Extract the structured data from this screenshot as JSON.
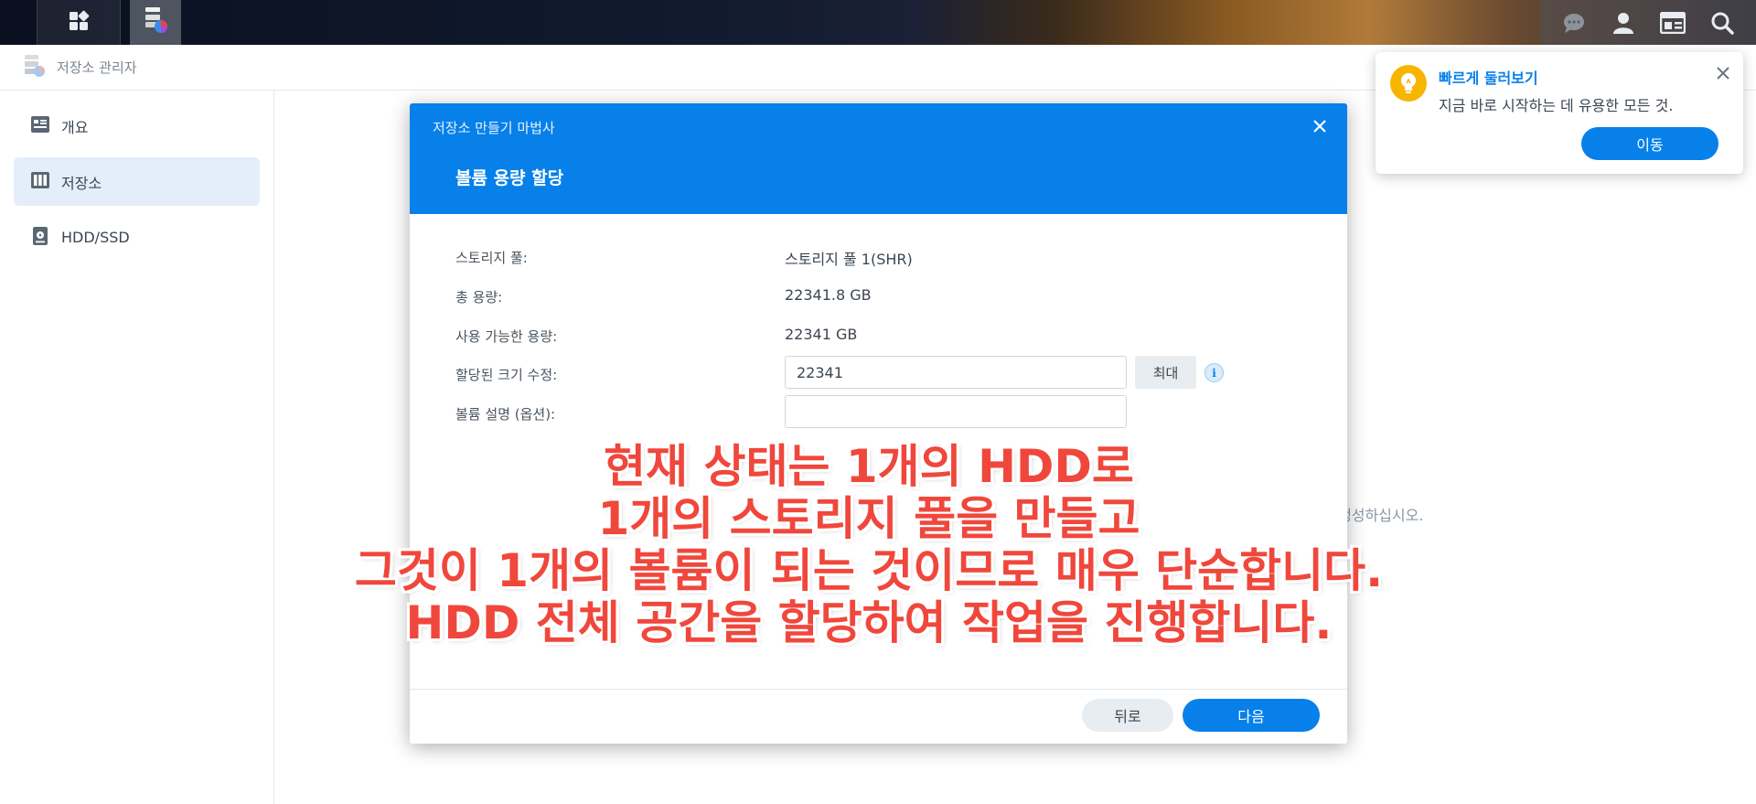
{
  "taskbar": {
    "icons": [
      "main-menu-icon",
      "storage-manager-app-icon",
      "chat-icon",
      "user-icon",
      "widgets-icon",
      "search-icon"
    ]
  },
  "window": {
    "title": "저장소 관리자"
  },
  "sidebar": {
    "items": [
      {
        "label": "개요",
        "icon": "overview-icon",
        "active": false
      },
      {
        "label": "저장소",
        "icon": "storage-icon",
        "active": true
      },
      {
        "label": "HDD/SSD",
        "icon": "hdd-icon",
        "active": false
      }
    ]
  },
  "main": {
    "hint_fragment": "생성하십시오."
  },
  "dialog": {
    "wizard_title": "저장소 만들기 마법사",
    "step_title": "볼륨 용량 할당",
    "rows": [
      {
        "label": "스토리지 풀:",
        "value": "스토리지 풀 1(SHR)"
      },
      {
        "label": "총 용량:",
        "value": "22341.8 GB"
      },
      {
        "label": "사용 가능한 용량:",
        "value": "22341 GB"
      },
      {
        "label": "할당된 크기 수정:",
        "value": "22341"
      },
      {
        "label": "볼륨 설명 (옵션):",
        "value": ""
      }
    ],
    "max_label": "최대",
    "info_glyph": "i",
    "back_label": "뒤로",
    "next_label": "다음"
  },
  "annotation": {
    "lines": [
      "현재 상태는 1개의 HDD로",
      "1개의 스토리지 풀을 만들고",
      "그것이 1개의 볼륨이 되는 것이므로 매우 단순합니다.",
      "HDD 전체 공간을 할당하여 작업을 진행합니다."
    ],
    "color": "#f0473c"
  },
  "toast": {
    "title": "빠르게 둘러보기",
    "text": "지금 바로 시작하는 데 유용한 모든 것.",
    "button_label": "이동",
    "icon": "lightbulb-icon"
  },
  "colors": {
    "accent": "#0780ea",
    "sidebar_active": "#e4eefa"
  }
}
